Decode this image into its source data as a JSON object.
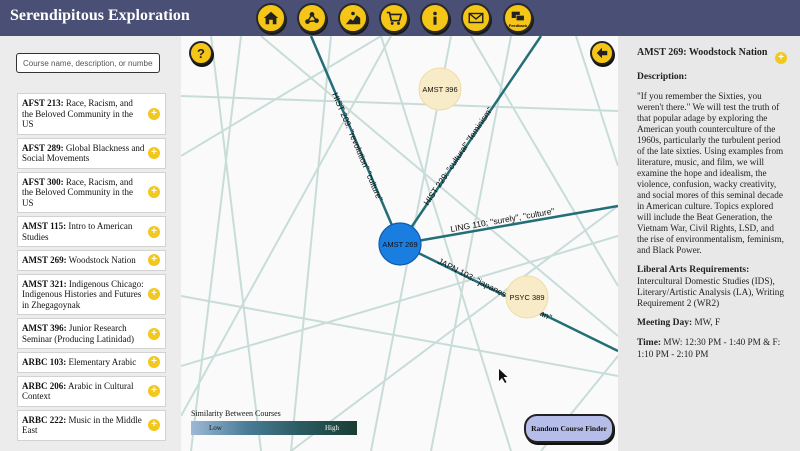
{
  "app": {
    "title": "Serendipitous Exploration"
  },
  "nav": [
    {
      "icon": "home-icon"
    },
    {
      "icon": "network-icon"
    },
    {
      "icon": "explore-icon"
    },
    {
      "icon": "cart-icon"
    },
    {
      "icon": "info-icon"
    },
    {
      "icon": "mail-icon"
    },
    {
      "icon": "feedback-icon",
      "label": "Feedback"
    }
  ],
  "search": {
    "placeholder": "Course name, description, or number"
  },
  "courses": [
    {
      "code": "AFST 213:",
      "name": " Race, Racism, and the Beloved Community in the US"
    },
    {
      "code": "AFST 289:",
      "name": " Global Blackness and Social Movements"
    },
    {
      "code": "AFST 300:",
      "name": " Race, Racism, and the Beloved Community in the US"
    },
    {
      "code": "AMST 115:",
      "name": " Intro to American Studies"
    },
    {
      "code": "AMST 269:",
      "name": " Woodstock Nation"
    },
    {
      "code": "AMST 321:",
      "name": " Indigenous Chicago: Indigenous Histories and Futures in Zhegagoynak"
    },
    {
      "code": "AMST 396:",
      "name": " Junior Research Seminar (Producing Latinidad)"
    },
    {
      "code": "ARBC 103:",
      "name": " Elementary Arabic"
    },
    {
      "code": "ARBC 206:",
      "name": " Arabic in Cultural Context"
    },
    {
      "code": "ARBC 222:",
      "name": " Music in the Middle East"
    }
  ],
  "graph": {
    "center_node": "AMST 269",
    "nodes": [
      "AMST 396",
      "PSYC 389"
    ],
    "edges": [
      {
        "label": "HIST 209: \"revolution\" \"culture\""
      },
      {
        "label": "HIST 229: \"cultural\" \"feminism\""
      },
      {
        "label": "LING 110: \"surely\", \"culture\""
      },
      {
        "label": "JAPN 103: \"japanese\" \"american\""
      }
    ],
    "help_icon": "question-icon",
    "back_icon": "arrow-left-icon",
    "legend": {
      "title": "Similarity Between Courses",
      "low": "Low",
      "high": "High"
    },
    "random_button": "Random Course Finder"
  },
  "detail": {
    "title": "AMST 269: Woodstock Nation",
    "description_heading": "Description:",
    "description": "\"If you remember the Sixties, you weren't there.\" We will test the truth of that popular adage by exploring the American youth counterculture of the 1960s, particularly the turbulent period of the late sixties. Using examples from literature, music, and film, we will examine the hope and idealism, the violence, confusion, wacky creativity, and social mores of this seminal decade in American culture. Topics explored will include the Beat Generation, the Vietnam War, Civil Rights, LSD, and the rise of environmentalism, feminism, and Black Power.",
    "req_heading": "Liberal Arts Requirements:",
    "requirements": "Intercultural Domestic Studies (IDS), Literary/Artistic Analysis (LA), Writing Requirement 2 (WR2)",
    "meeting_heading": "Meeting Day:",
    "meeting": " MW, F",
    "time_heading": "Time:",
    "time": " MW: 12:30 PM - 1:40 PM & F: 1:10 PM - 2:10 PM"
  },
  "colors": {
    "topbar": "#4a5075",
    "accent": "#f5c518",
    "center_node": "#1a7de0",
    "edge": "#236e78"
  }
}
